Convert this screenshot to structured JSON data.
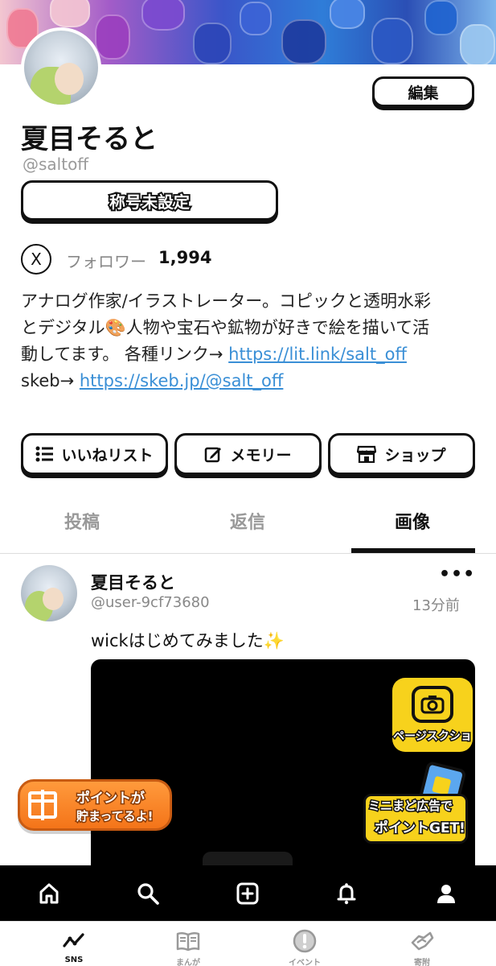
{
  "profile": {
    "edit_label": "編集",
    "name": "夏目そると",
    "handle": "@saltoff",
    "title_button": "称号未設定",
    "x_badge": "X",
    "followers_label": "フォロワー",
    "followers_count": "1,994",
    "bio_line1": "アナログ作家/イラストレーター。コピックと透明水彩",
    "bio_line2": "とデジタル🎨人物や宝石や鉱物が好きで絵を描いて活",
    "bio_line3_prefix": "動してます。 各種リンク→ ",
    "bio_link1": "https://lit.link/salt_off",
    "bio_line4_prefix": "skeb→ ",
    "bio_link2": "https://skeb.jp/@salt_off"
  },
  "actions": [
    {
      "label": "いいねリスト",
      "icon": "list-icon"
    },
    {
      "label": "メモリー",
      "icon": "edit-icon"
    },
    {
      "label": "ショップ",
      "icon": "shop-icon"
    }
  ],
  "tabs": [
    {
      "label": "投稿"
    },
    {
      "label": "返信"
    },
    {
      "label": "画像"
    }
  ],
  "active_tab": "画像",
  "post": {
    "author": "夏目そると",
    "handle": "@user-9cf73680",
    "time": "13分前",
    "more": "•••",
    "text": "wickはじめてみました✨"
  },
  "floats": {
    "screenshot_label": "ページスクショ",
    "ad_line1": "ミニまど広告で",
    "ad_line2": "ポイントGET!",
    "points_line1": "ポイントが",
    "points_line2": "貯まってるよ!"
  },
  "app_nav": [
    {
      "icon": "home-icon"
    },
    {
      "icon": "search-icon"
    },
    {
      "icon": "add-post-icon"
    },
    {
      "icon": "bell-icon"
    },
    {
      "icon": "profile-icon"
    }
  ],
  "bottom_nav": [
    {
      "label": "SNS",
      "icon": "sns-icon"
    },
    {
      "label": "まんが",
      "icon": "book-icon"
    },
    {
      "label": "イベント",
      "icon": "event-icon"
    },
    {
      "label": "寄附",
      "icon": "donate-icon"
    }
  ],
  "colors": {
    "link": "#3a8fd6",
    "accent_yellow": "#f7d21c",
    "accent_orange": "#f47419"
  }
}
